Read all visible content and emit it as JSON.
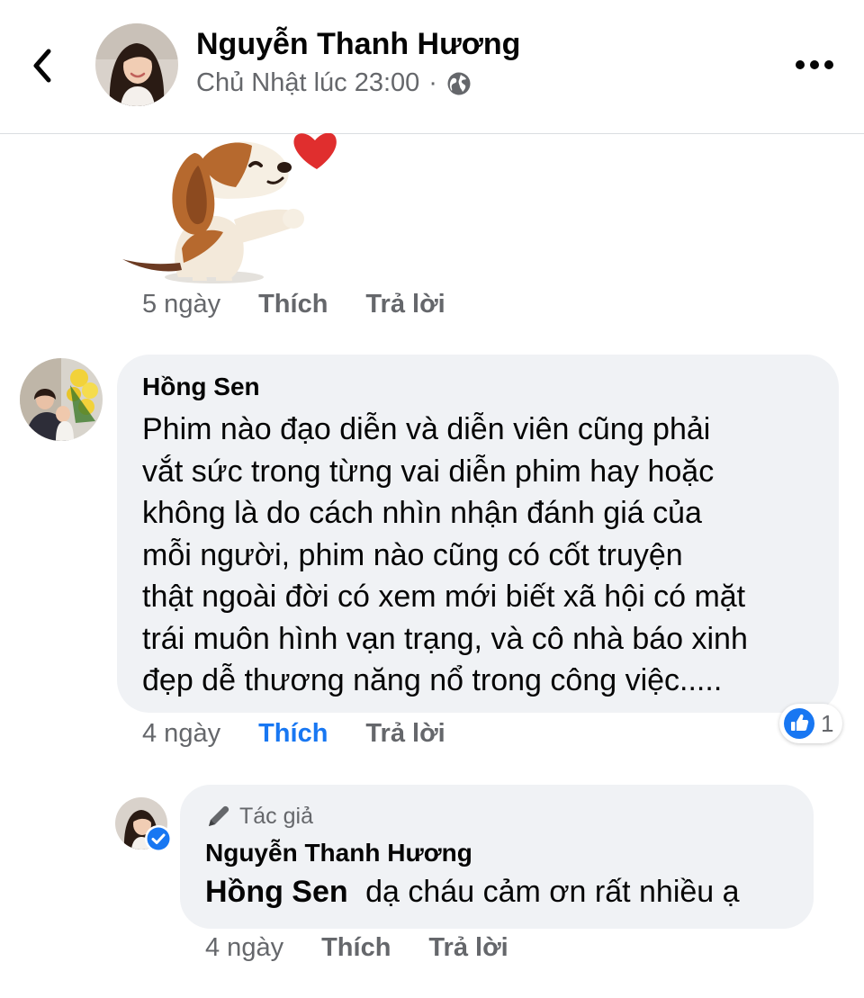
{
  "header": {
    "back_icon": "chevron-left-icon",
    "author_name": "Nguyễn Thanh Hương",
    "timestamp": "Chủ Nhật lúc 23:00",
    "separator": "·",
    "privacy_icon": "globe-icon",
    "more_icon": "more-horizontal-icon"
  },
  "sticker_comment": {
    "sticker": "dog-with-heart-sticker",
    "time": "5 ngày",
    "like_label": "Thích",
    "reply_label": "Trả lời"
  },
  "comment": {
    "author": "Hồng Sen",
    "lines": [
      "Phim nào đạo diễn và diễn viên cũng phải",
      "vắt sức trong từng vai diễn phim hay hoặc",
      "không là do cách nhìn nhận đánh giá của",
      "mỗi người, phim nào cũng có cốt truyện",
      "thật ngoài đời có xem mới biết xã hội có mặt",
      "trái muôn hình vạn trạng, và cô nhà báo xinh",
      "đẹp dễ thương năng nổ trong công việc....."
    ],
    "time": "4 ngày",
    "like_label": "Thích",
    "reply_label": "Trả lời",
    "reaction_icon": "like-icon",
    "reaction_count": "1",
    "colors": {
      "liked": "#1877f2"
    }
  },
  "reply": {
    "badge_icon": "pencil-icon",
    "badge_label": "Tác giả",
    "author": "Nguyễn Thanh Hương",
    "mention": "Hồng Sen",
    "text": "dạ cháu cảm ơn rất nhiều ạ",
    "verified_icon": "verified-check-icon",
    "time": "4 ngày",
    "like_label": "Thích",
    "reply_label": "Trả lời"
  },
  "colors": {
    "bubble": "#f0f2f5",
    "secondary_text": "#65676b",
    "accent": "#1877f2"
  }
}
